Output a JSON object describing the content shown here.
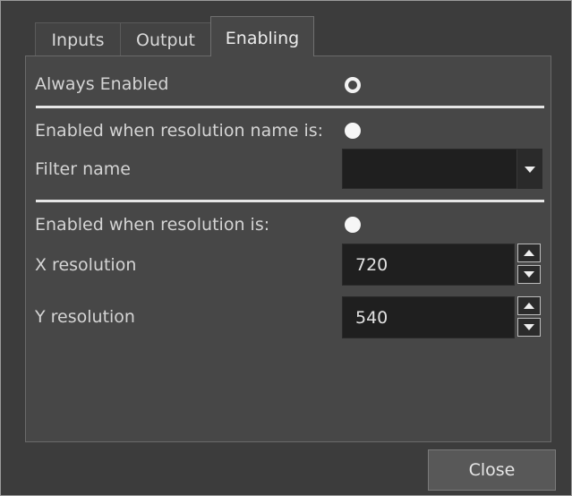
{
  "tabs": {
    "inputs": "Inputs",
    "output": "Output",
    "enabling": "Enabling"
  },
  "enabling": {
    "always_enabled_label": "Always Enabled",
    "enabled_when_name_label": "Enabled when resolution name is:",
    "filter_name_label": "Filter name",
    "filter_name_value": "",
    "enabled_when_resolution_label": "Enabled when resolution is:",
    "x_resolution_label": "X resolution",
    "x_resolution_value": "720",
    "y_resolution_label": "Y resolution",
    "y_resolution_value": "540",
    "selected_option": "always_enabled"
  },
  "footer": {
    "close_label": "Close"
  },
  "icons": {
    "dropdown": "chevron-down-icon",
    "spin_up": "triangle-up-icon",
    "spin_down": "triangle-down-icon"
  },
  "colors": {
    "panel_bg": "#474747",
    "field_bg": "#1f1f1f",
    "text": "#d4d4d4"
  }
}
